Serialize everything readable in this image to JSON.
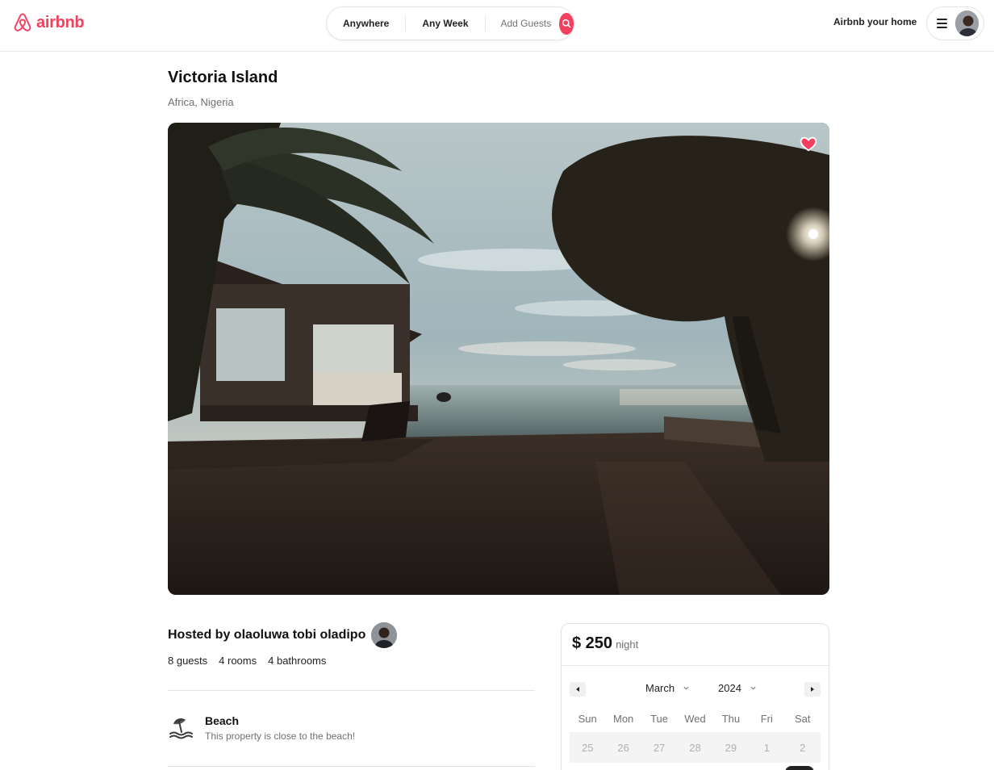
{
  "nav": {
    "logo_text": "airbnb",
    "search": {
      "where_label": "Anywhere",
      "when_label": "Any Week",
      "guests_label": "Add Guests"
    },
    "host_link": "Airbnb your home"
  },
  "listing": {
    "title": "Victoria Island",
    "location": "Africa, Nigeria",
    "favorited": true
  },
  "host": {
    "hosted_by": "Hosted by olaoluwa tobi oladipo",
    "stats": [
      "8 guests",
      "4 rooms",
      "4 bathrooms"
    ]
  },
  "feature": {
    "title": "Beach",
    "description": "This property is close to the beach!",
    "icon": "beach-umbrella-icon"
  },
  "booking": {
    "price": "$ 250",
    "price_unit": "night",
    "calendar": {
      "month": "March",
      "year": "2024",
      "weekdays": [
        "Sun",
        "Mon",
        "Tue",
        "Wed",
        "Thu",
        "Fri",
        "Sat"
      ],
      "first_row": [
        "25",
        "26",
        "27",
        "28",
        "29",
        "1",
        "2"
      ]
    }
  },
  "colors": {
    "brand": "#f43f5e",
    "text": "#222222",
    "muted": "#717171"
  }
}
